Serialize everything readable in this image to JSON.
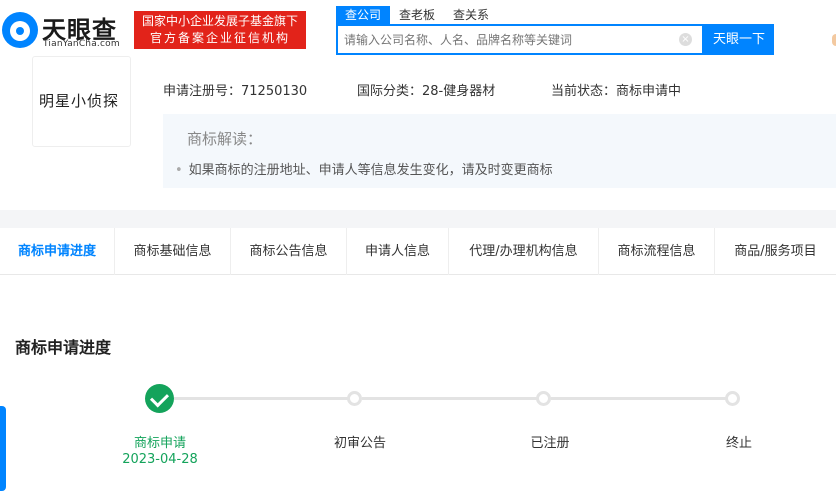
{
  "header": {
    "logo_text": "天眼查",
    "logo_url": "TianYanCha.com",
    "badge_line1": "国家中小企业发展子基金旗下",
    "badge_line2": "官方备案企业征信机构",
    "search_tabs": [
      "查公司",
      "查老板",
      "查关系"
    ],
    "search_placeholder": "请输入公司名称、人名、品牌名称等关键词",
    "search_button": "天眼一下"
  },
  "trademark": {
    "name": "明星小侦探",
    "reg_no": "申请注册号：71250130",
    "intl_class": "国际分类：28-健身器材",
    "status": "当前状态：商标申请中"
  },
  "interpretation": {
    "title": "商标解读：",
    "text": "如果商标的注册地址、申请人等信息发生变化，请及时变更商标"
  },
  "tabs": [
    "商标申请进度",
    "商标基础信息",
    "商标公告信息",
    "申请人信息",
    "代理/办理机构信息",
    "商标流程信息",
    "商品/服务项目"
  ],
  "progress": {
    "title": "商标申请进度",
    "steps": [
      "商标申请",
      "初审公告",
      "已注册",
      "终止"
    ],
    "date": "2023-04-28",
    "accent": "#14a35b"
  }
}
